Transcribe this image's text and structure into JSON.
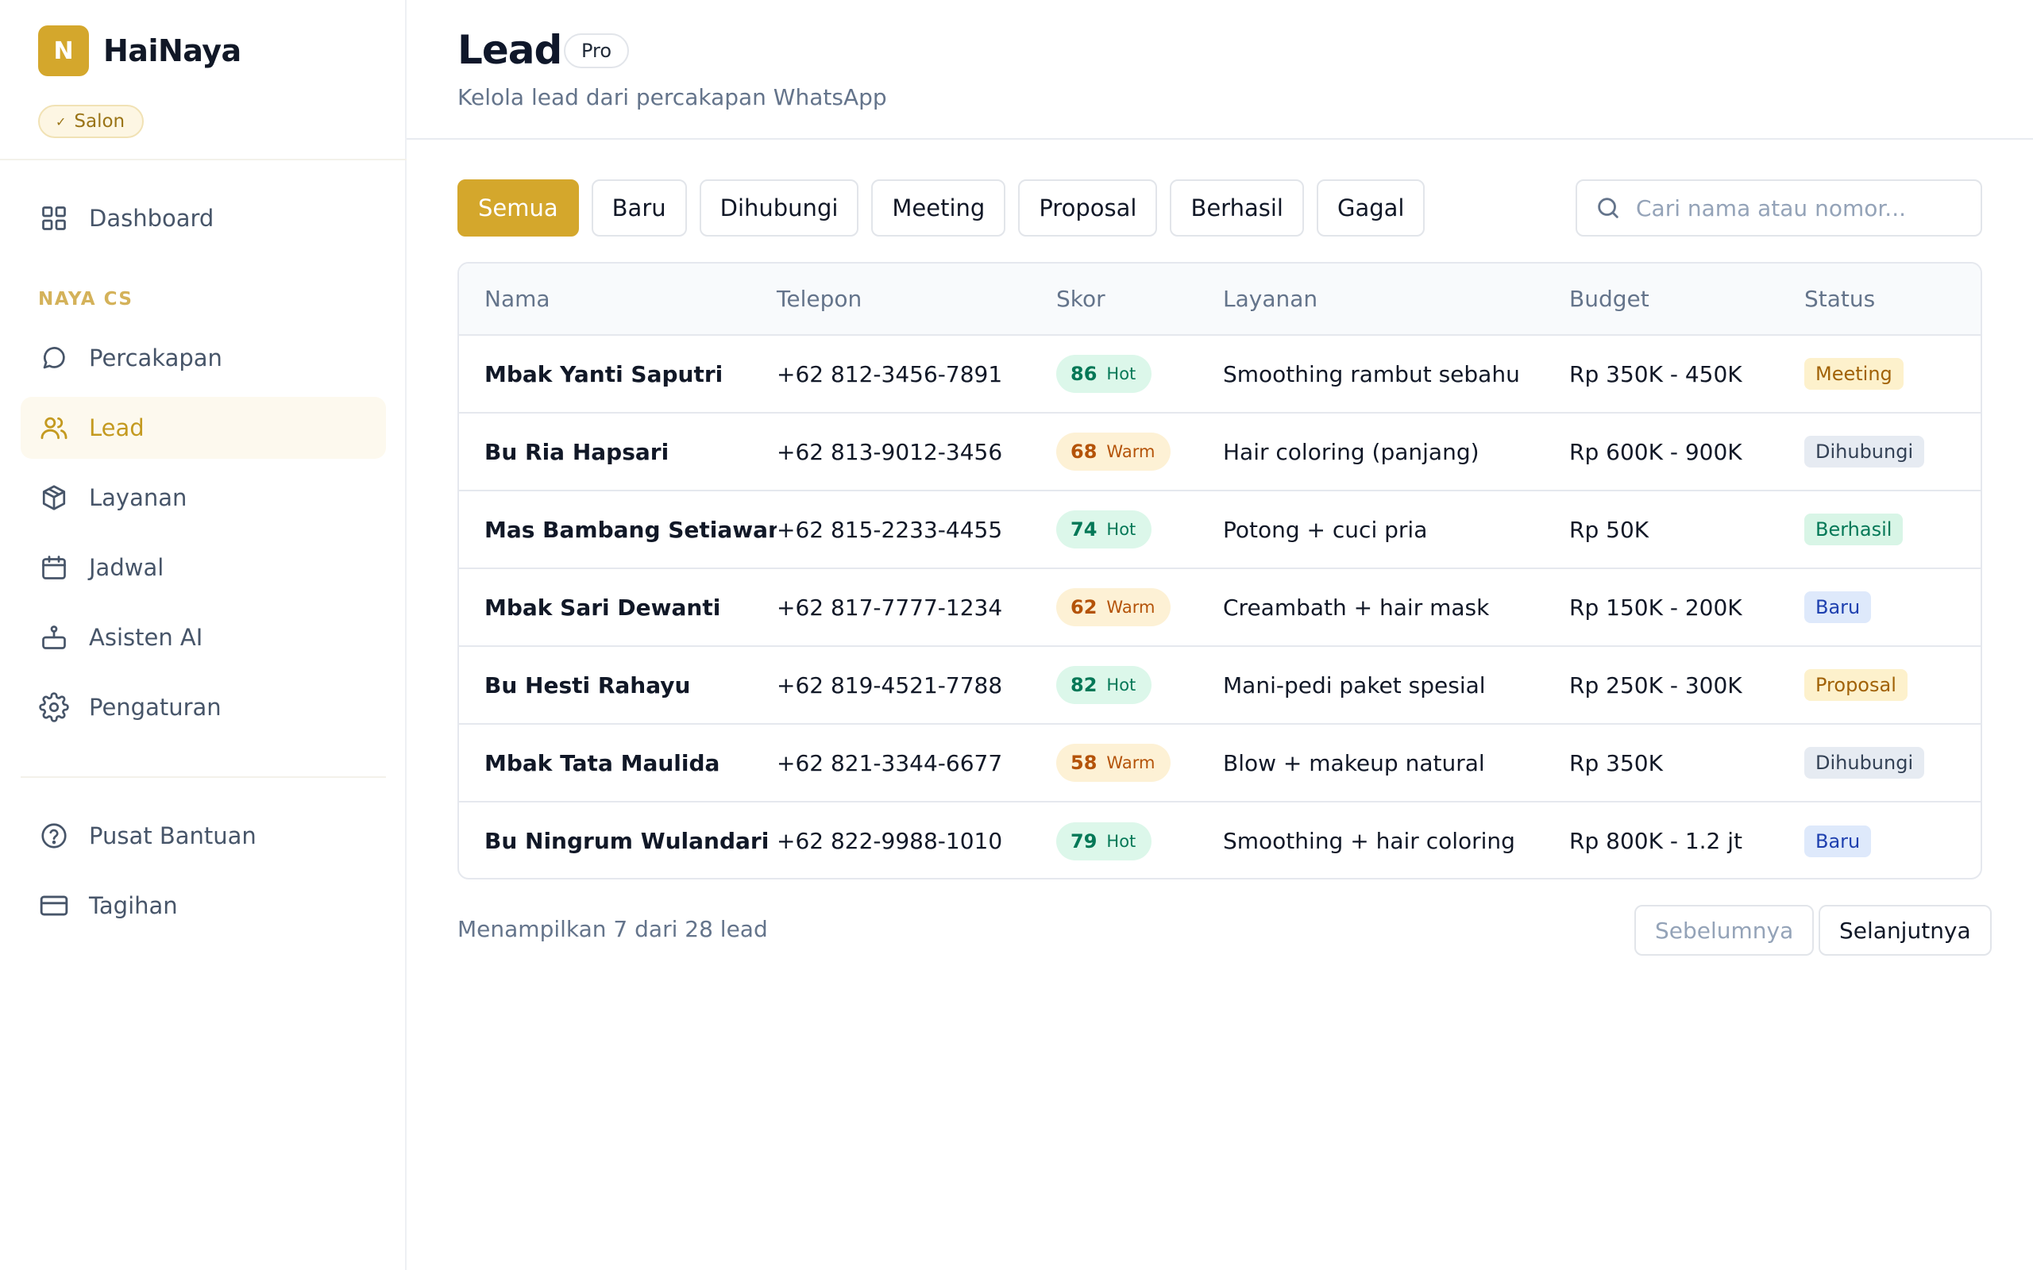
{
  "brand": {
    "logo_letter": "N",
    "name": "HaiNaya",
    "badge": "Salon",
    "accent": "#d4a72c"
  },
  "sidebar": {
    "dashboard": "Dashboard",
    "section_label": "NAYA CS",
    "items": [
      {
        "label": "Percakapan",
        "icon": "chat-icon"
      },
      {
        "label": "Lead",
        "icon": "users-icon",
        "active": true
      },
      {
        "label": "Layanan",
        "icon": "box-icon"
      },
      {
        "label": "Jadwal",
        "icon": "calendar-icon"
      },
      {
        "label": "Asisten AI",
        "icon": "robot-icon"
      },
      {
        "label": "Pengaturan",
        "icon": "gear-icon"
      }
    ],
    "bottom_items": [
      {
        "label": "Pusat Bantuan",
        "icon": "help-icon"
      },
      {
        "label": "Tagihan",
        "icon": "credit-card-icon"
      }
    ]
  },
  "header": {
    "title": "Lead",
    "badge": "Pro",
    "subtitle": "Kelola lead dari percakapan WhatsApp"
  },
  "filters": [
    "Semua",
    "Baru",
    "Dihubungi",
    "Meeting",
    "Proposal",
    "Berhasil",
    "Gagal"
  ],
  "active_filter": "Semua",
  "search": {
    "placeholder": "Cari nama atau nomor..."
  },
  "table": {
    "columns": [
      "Nama",
      "Telepon",
      "Skor",
      "Layanan",
      "Budget",
      "Status"
    ],
    "rows": [
      {
        "name": "Mbak Yanti Saputri",
        "phone": "+62 812-3456-7891",
        "score": "86",
        "score_label": "Hot",
        "service": "Smoothing rambut sebahu",
        "budget": "Rp 350K - 450K",
        "status": "Meeting"
      },
      {
        "name": "Bu Ria Hapsari",
        "phone": "+62 813-9012-3456",
        "score": "68",
        "score_label": "Warm",
        "service": "Hair coloring (panjang)",
        "budget": "Rp 600K - 900K",
        "status": "Dihubungi"
      },
      {
        "name": "Mas Bambang Setiawan",
        "phone": "+62 815-2233-4455",
        "score": "74",
        "score_label": "Hot",
        "service": "Potong + cuci pria",
        "budget": "Rp 50K",
        "status": "Berhasil"
      },
      {
        "name": "Mbak Sari Dewanti",
        "phone": "+62 817-7777-1234",
        "score": "62",
        "score_label": "Warm",
        "service": "Creambath + hair mask",
        "budget": "Rp 150K - 200K",
        "status": "Baru"
      },
      {
        "name": "Bu Hesti Rahayu",
        "phone": "+62 819-4521-7788",
        "score": "82",
        "score_label": "Hot",
        "service": "Mani-pedi paket spesial",
        "budget": "Rp 250K - 300K",
        "status": "Proposal"
      },
      {
        "name": "Mbak Tata Maulida",
        "phone": "+62 821-3344-6677",
        "score": "58",
        "score_label": "Warm",
        "service": "Blow + makeup natural",
        "budget": "Rp 350K",
        "status": "Dihubungi"
      },
      {
        "name": "Bu Ningrum Wulandari",
        "phone": "+62 822-9988-1010",
        "score": "79",
        "score_label": "Hot",
        "service": "Smoothing + hair coloring",
        "budget": "Rp 800K - 1.2 jt",
        "status": "Baru"
      }
    ]
  },
  "footer": {
    "info": "Menampilkan 7 dari 28 lead",
    "prev": "Sebelumnya",
    "next": "Selanjutnya"
  }
}
